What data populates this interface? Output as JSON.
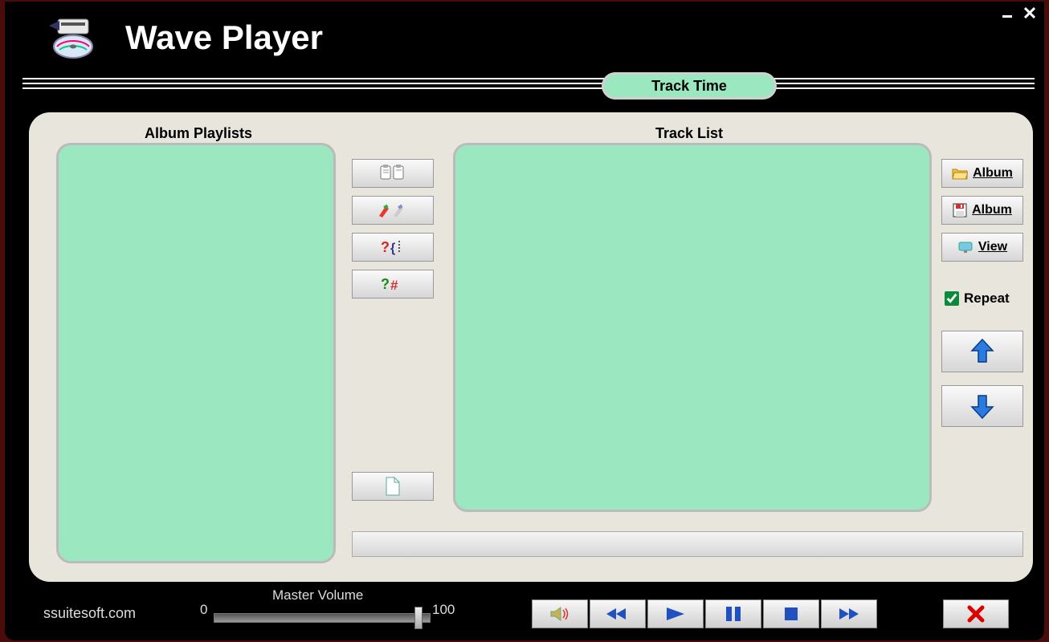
{
  "app": {
    "title": "Wave Player",
    "track_time_label": "Track Time"
  },
  "labels": {
    "album_playlists": "Album Playlists",
    "track_list": "Track List",
    "repeat": "Repeat",
    "master_volume": "Master Volume"
  },
  "buttons": {
    "open_album": "Album",
    "save_album": "Album",
    "view": "View"
  },
  "repeat_checked": true,
  "volume": {
    "min": "0",
    "max": "100",
    "value": 100
  },
  "footer": {
    "link": "ssuitesoft.com"
  },
  "playlists": [],
  "tracks": []
}
